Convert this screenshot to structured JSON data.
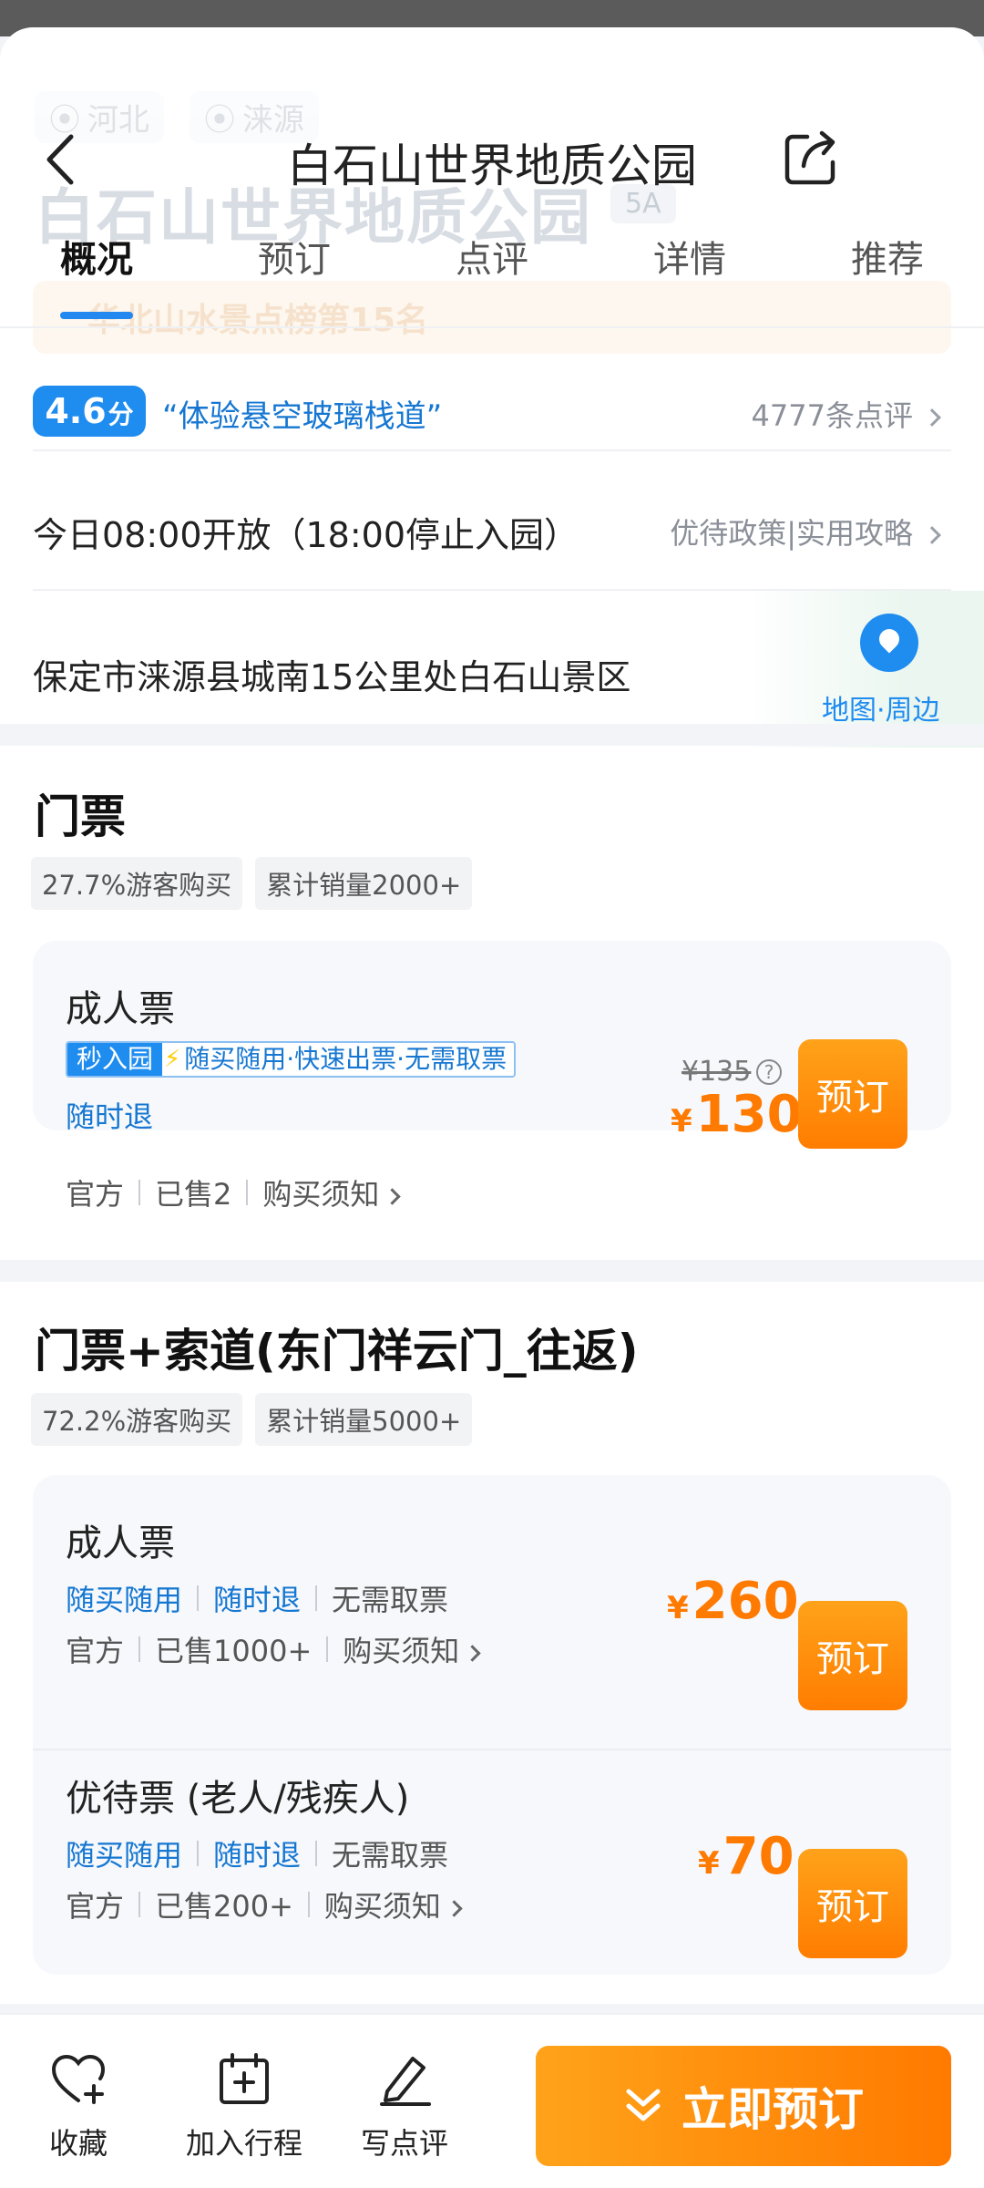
{
  "ghost": {
    "province": "河北",
    "county": "涞源",
    "big_title": "白石山世界地质公园",
    "level": "5A",
    "rank": "华北山水景点榜第15名"
  },
  "header": {
    "title": "白石山世界地质公园"
  },
  "tabs": [
    {
      "label": "概况"
    },
    {
      "label": "预订"
    },
    {
      "label": "点评"
    },
    {
      "label": "详情"
    },
    {
      "label": "推荐"
    }
  ],
  "rating": {
    "score": "4.6",
    "unit": "分",
    "highlight": "“体验悬空玻璃栈道”",
    "review_count": "4777条点评"
  },
  "hours": {
    "text": "今日08:00开放（18:00停止入园）",
    "policy_link": "优待政策|实用攻略"
  },
  "address": {
    "text": "保定市涞源县城南15公里处白石山景区",
    "map_label": "地图·周边"
  },
  "sections": [
    {
      "title": "门票",
      "chips": [
        "27.7%游客购买",
        "累计销量2000+"
      ],
      "tickets": [
        {
          "name": "成人票",
          "fast_badge_left": "秒入园",
          "fast_badge_right": "随买随用·快速出票·无需取票",
          "tag": "随时退",
          "meta": [
            "官方",
            "已售2",
            "购买须知"
          ],
          "original_price": "¥135",
          "currency": "¥",
          "price": "130",
          "button": "预订"
        }
      ]
    },
    {
      "title": "门票+索道(东门祥云门_往返)",
      "chips": [
        "72.2%游客购买",
        "累计销量5000+"
      ],
      "tickets": [
        {
          "name": "成人票",
          "tags": [
            "随买随用",
            "随时退",
            "无需取票"
          ],
          "meta": [
            "官方",
            "已售1000+",
            "购买须知"
          ],
          "currency": "¥",
          "price": "260",
          "button": "预订"
        },
        {
          "name": "优待票 (老人/残疾人)",
          "tags": [
            "随买随用",
            "随时退",
            "无需取票"
          ],
          "meta": [
            "官方",
            "已售200+",
            "购买须知"
          ],
          "currency": "¥",
          "price": "70",
          "button": "预订"
        }
      ]
    }
  ],
  "bottom_bar": {
    "favorite": "收藏",
    "add_itinerary": "加入行程",
    "write_review": "写点评",
    "book_now": "立即预订"
  },
  "colors": {
    "accent_blue": "#1f8cf0",
    "price_orange": "#ff7a00"
  }
}
